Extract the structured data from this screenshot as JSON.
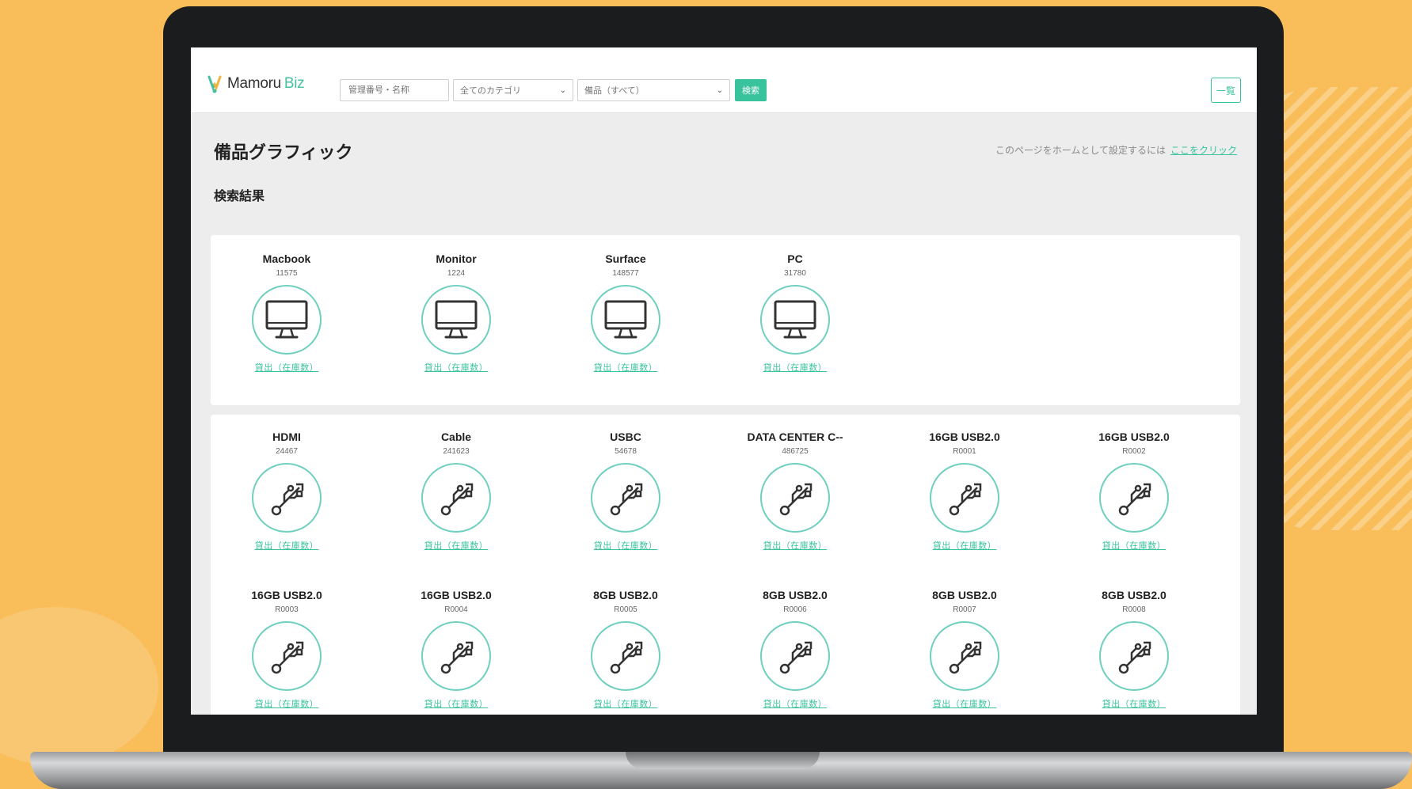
{
  "header": {
    "logo_name": "Mamoru",
    "logo_suffix": "Biz",
    "search_placeholder": "管理番号・名称",
    "select_category": "全てのカテゴリ",
    "select_type": "備品（すべて）",
    "search_button": "検索",
    "right_button": "一覧"
  },
  "page": {
    "title": "備品グラフィック",
    "home_note": "このページをホームとして設定するには",
    "home_link": "ここをクリック",
    "section_title": "検索結果"
  },
  "groups": [
    {
      "items": [
        {
          "name": "Macbook",
          "code": "11575",
          "link": "貸出（在庫数）",
          "icon": "monitor-icon"
        },
        {
          "name": "Monitor",
          "code": "1224",
          "link": "貸出（在庫数）",
          "icon": "monitor-icon"
        },
        {
          "name": "Surface",
          "code": "148577",
          "link": "貸出（在庫数）",
          "icon": "monitor-icon"
        },
        {
          "name": "PC",
          "code": "31780",
          "link": "貸出（在庫数）",
          "icon": "monitor-icon"
        }
      ]
    },
    {
      "items": [
        {
          "name": "HDMI",
          "code": "24467",
          "link": "貸出（在庫数）",
          "icon": "usb-icon"
        },
        {
          "name": "Cable",
          "code": "241623",
          "link": "貸出（在庫数）",
          "icon": "usb-icon"
        },
        {
          "name": "USBC",
          "code": "54678",
          "link": "貸出（在庫数）",
          "icon": "usb-icon"
        },
        {
          "name": "DATA CENTER C--",
          "code": "486725",
          "link": "貸出（在庫数）",
          "icon": "usb-icon"
        },
        {
          "name": "16GB USB2.0",
          "code": "R0001",
          "link": "貸出（在庫数）",
          "icon": "usb-icon"
        },
        {
          "name": "16GB USB2.0",
          "code": "R0002",
          "link": "貸出（在庫数）",
          "icon": "usb-icon"
        },
        {
          "name": "16GB USB2.0",
          "code": "R0003",
          "link": "貸出（在庫数）",
          "icon": "usb-icon"
        },
        {
          "name": "16GB USB2.0",
          "code": "R0004",
          "link": "貸出（在庫数）",
          "icon": "usb-icon"
        },
        {
          "name": "8GB USB2.0",
          "code": "R0005",
          "link": "貸出（在庫数）",
          "icon": "usb-icon"
        },
        {
          "name": "8GB USB2.0",
          "code": "R0006",
          "link": "貸出（在庫数）",
          "icon": "usb-icon"
        },
        {
          "name": "8GB USB2.0",
          "code": "R0007",
          "link": "貸出（在庫数）",
          "icon": "usb-icon"
        },
        {
          "name": "8GB USB2.0",
          "code": "R0008",
          "link": "貸出（在庫数）",
          "icon": "usb-icon"
        }
      ]
    }
  ],
  "colors": {
    "background": "#F9BE5A",
    "accent": "#39C39D",
    "icon_ring": "#6FCFBF"
  }
}
